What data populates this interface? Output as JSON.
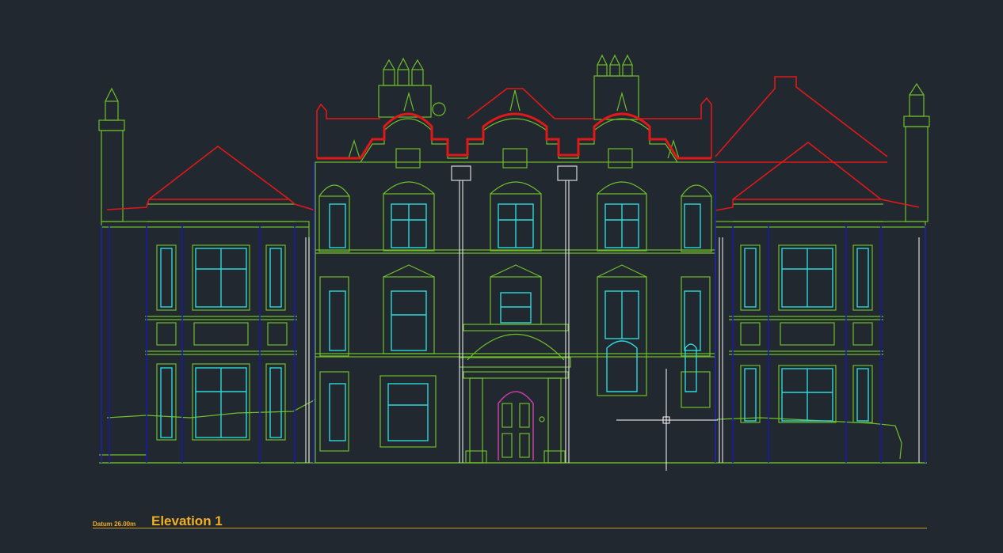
{
  "drawing": {
    "datum_label": "Datum 26.00m",
    "elevation_title": "Elevation 1"
  },
  "colors": {
    "background": "#212830",
    "wall_lines": "#6fbf2a",
    "roof_lines": "#e01818",
    "glazing": "#2fd8d8",
    "columns": "#1a1aa8",
    "downpipes": "#d8d8d8",
    "door": "#c040a0",
    "title_text": "#f2b01e",
    "crosshair": "#ffffff"
  },
  "cursor": {
    "icon": "crosshair-cursor-icon"
  }
}
